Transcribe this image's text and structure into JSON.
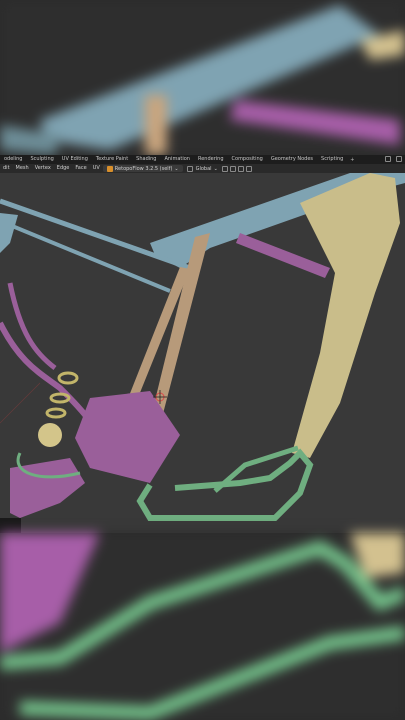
{
  "workspace_tabs": [
    "odeling",
    "Sculpting",
    "UV Editing",
    "Texture Paint",
    "Shading",
    "Animation",
    "Rendering",
    "Compositing",
    "Geometry Nodes",
    "Scripting"
  ],
  "workspace_add": "+",
  "header_menus": [
    "dit",
    "Mesh",
    "Vertex",
    "Edge",
    "Face",
    "UV"
  ],
  "addon_label": "RetopoFlow 3.2.5 (self)",
  "transform_orientation": "Global",
  "colors": {
    "frame_blue": "#7fa3b2",
    "strut_tan": "#b79a7a",
    "rod_purple": "#9a5f9a",
    "pipe_green": "#6fae80",
    "plate_khaki": "#c9bd8a",
    "viewport_bg": "#393939"
  }
}
